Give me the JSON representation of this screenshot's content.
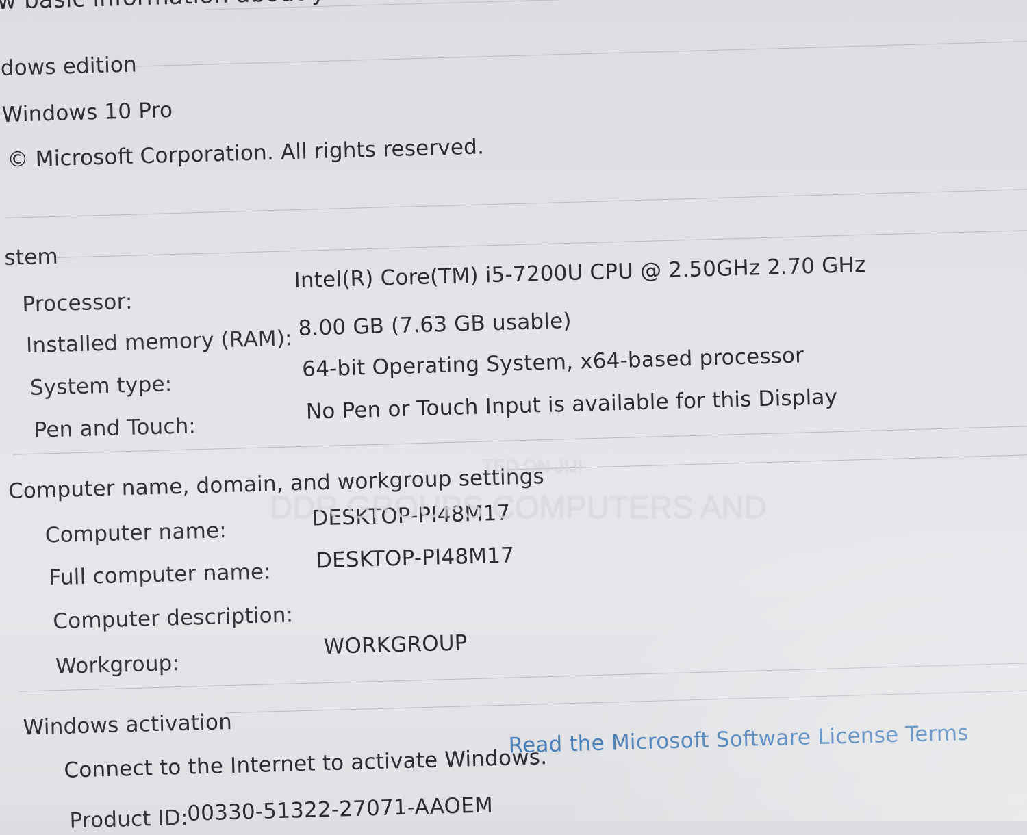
{
  "header": {
    "title_partial": "w basic information about y"
  },
  "edition": {
    "section_title": "dows edition",
    "name": "Windows 10 Pro",
    "copyright": "© Microsoft Corporation. All rights reserved."
  },
  "system": {
    "section_title": "stem",
    "rows": [
      {
        "label": "Processor:",
        "value": "Intel(R) Core(TM) i5-7200U CPU @ 2.50GHz   2.70 GHz"
      },
      {
        "label": "Installed memory (RAM):",
        "value": "8.00 GB (7.63 GB usable)"
      },
      {
        "label": "System type:",
        "value": "64-bit Operating System, x64-based processor"
      },
      {
        "label": "Pen and Touch:",
        "value": "No Pen or Touch Input is available for this Display"
      }
    ]
  },
  "computer": {
    "section_title": "Computer name, domain, and workgroup settings",
    "rows": [
      {
        "label": "Computer name:",
        "value": "DESKTOP-PI48M17"
      },
      {
        "label": "Full computer name:",
        "value": "DESKTOP-PI48M17"
      },
      {
        "label": "Computer description:",
        "value": ""
      },
      {
        "label": "Workgroup:",
        "value": "WORKGROUP"
      }
    ]
  },
  "activation": {
    "section_title": "Windows activation",
    "status": "Connect to the Internet to activate Windows.",
    "license_link": "Read the Microsoft Software License Terms",
    "product_id_label": "Product ID:",
    "product_id": "00330-51322-27071-AAOEM"
  },
  "watermark": {
    "line1": "TED ON JIJI",
    "line2": "DDR GROUPS COMPUTERS AND"
  }
}
